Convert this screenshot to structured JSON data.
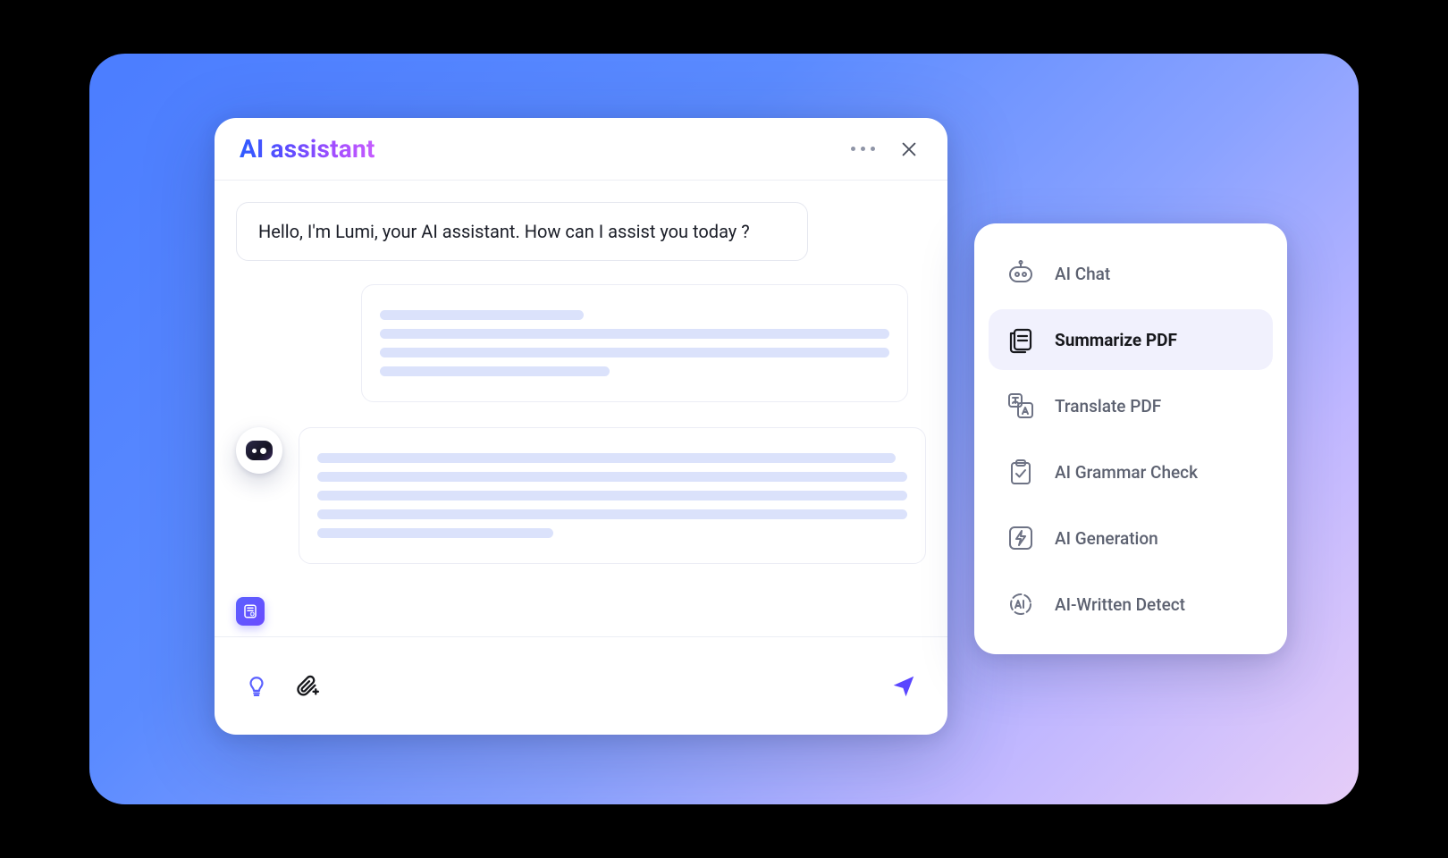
{
  "header": {
    "title": "AI assistant"
  },
  "chat": {
    "greeting": "Hello, I'm Lumi, your AI assistant. How can I assist you today ?"
  },
  "menu": {
    "items": [
      {
        "label": "AI Chat"
      },
      {
        "label": "Summarize PDF"
      },
      {
        "label": "Translate PDF"
      },
      {
        "label": "AI Grammar Check"
      },
      {
        "label": "AI Generation"
      },
      {
        "label": "AI-Written Detect"
      }
    ],
    "activeIndex": 1
  }
}
